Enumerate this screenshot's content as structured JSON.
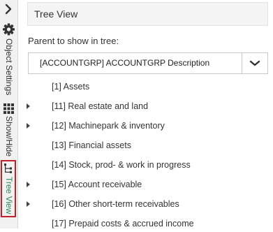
{
  "sidebar": {
    "collapse_icon": "chevron-right-icon",
    "object_settings": {
      "icon": "gear-icon",
      "label": "Object Settings"
    },
    "show_hide": {
      "icon": "grid-icon",
      "label": "Show/Hide"
    },
    "tree_view": {
      "icon": "tree-icon",
      "label": "Tree View",
      "active_color": "#2e8b57"
    },
    "active_border_color": "#c5202a"
  },
  "panel": {
    "title": "Tree View",
    "parent_label": "Parent to show in tree:",
    "parent_select": {
      "value": "[ACCOUNTGRP] ACCOUNTGRP Description",
      "icon": "chevron-down-icon"
    }
  },
  "tree": {
    "nodes": [
      {
        "label": "[1] Assets",
        "expandable": false
      },
      {
        "label": "[11] Real estate and land",
        "expandable": true
      },
      {
        "label": "[12] Machinepark & inventory",
        "expandable": true
      },
      {
        "label": "[13] Financial assets",
        "expandable": false
      },
      {
        "label": "[14] Stock, prod- & work in progress",
        "expandable": false
      },
      {
        "label": "[15] Account receivable",
        "expandable": true
      },
      {
        "label": "[16] Other short-term receivables",
        "expandable": true
      },
      {
        "label": "[17] Prepaid costs & accrued income",
        "expandable": false
      }
    ]
  }
}
